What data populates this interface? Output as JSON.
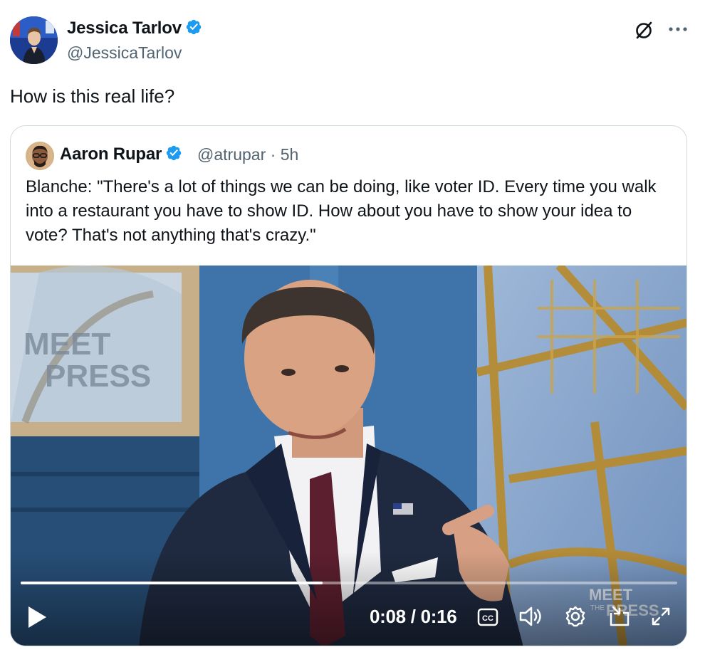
{
  "tweet": {
    "author_name": "Jessica Tarlov",
    "author_handle": "@JessicaTarlov",
    "text": "How is this real life?"
  },
  "quote": {
    "author_name": "Aaron Rupar",
    "author_handle": "@atrupar",
    "separator": "·",
    "age": "5h",
    "text": "Blanche: \"There's a lot of things we can be doing, like voter ID. Every time you walk into a restaurant you have to show ID. How about you have to show your idea to vote? That's not anything that's crazy.\""
  },
  "video": {
    "current_time": "0:08",
    "duration": "0:16",
    "progress_fraction": 0.46,
    "watermark_line1": "MEET",
    "watermark_line2": "THE PRESS"
  },
  "icons": {
    "verified": "verified-badge-icon",
    "grok": "grok-icon",
    "more": "more-icon",
    "play": "play-icon",
    "captions": "captions-icon",
    "volume": "volume-icon",
    "settings": "settings-icon",
    "pip": "picture-in-picture-icon",
    "fullscreen": "fullscreen-icon"
  },
  "colors": {
    "verified_blue": "#1d9bf0",
    "secondary_text": "#536471",
    "border": "#cfd9de"
  }
}
